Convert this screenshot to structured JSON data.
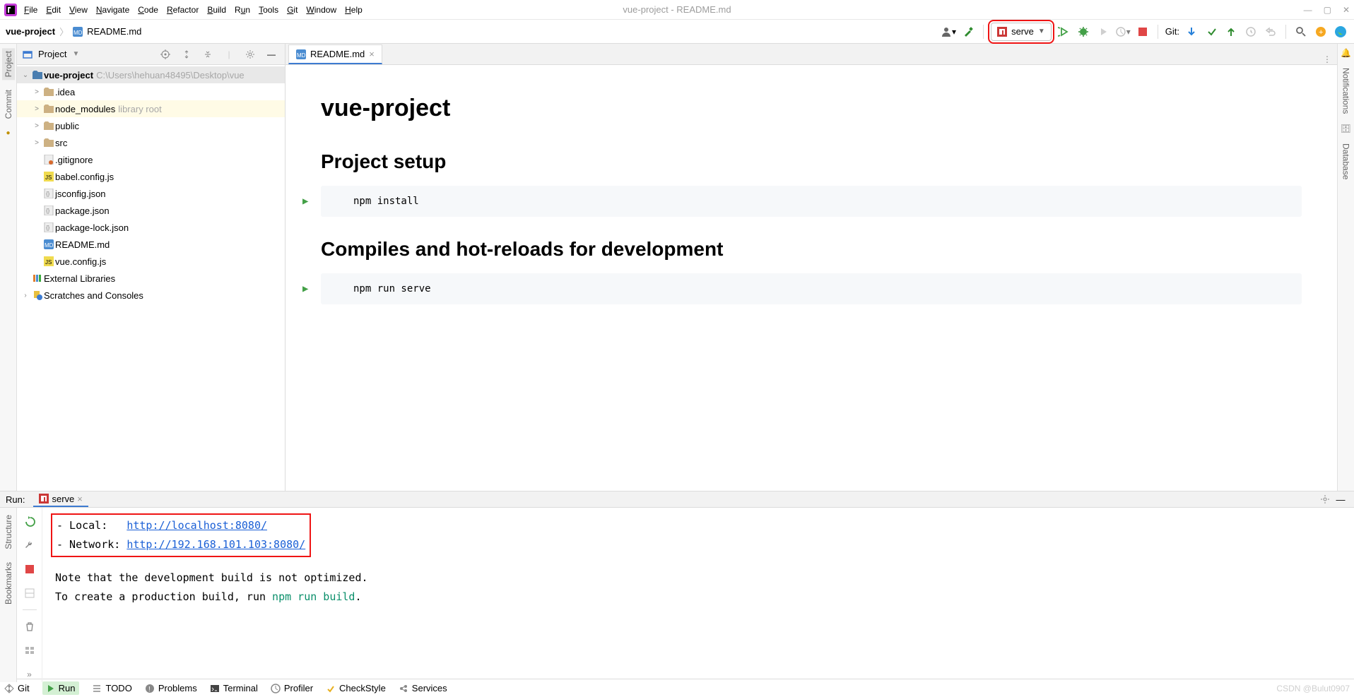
{
  "menu": {
    "items": [
      "File",
      "Edit",
      "View",
      "Navigate",
      "Code",
      "Refactor",
      "Build",
      "Run",
      "Tools",
      "Git",
      "Window",
      "Help"
    ]
  },
  "window": {
    "title": "vue-project - README.md"
  },
  "breadcrumb": {
    "root": "vue-project",
    "file": "README.md"
  },
  "toolbar": {
    "run_config": "serve",
    "git_label": "Git:"
  },
  "project": {
    "title": "Project",
    "root": "vue-project",
    "root_path": "C:\\Users\\hehuan48495\\Desktop\\vue",
    "items": [
      {
        "name": ".idea",
        "type": "dir",
        "indent": 2,
        "expand": ">"
      },
      {
        "name": "node_modules",
        "type": "dir",
        "indent": 2,
        "expand": ">",
        "note": "library root",
        "sel": true
      },
      {
        "name": "public",
        "type": "dir",
        "indent": 2,
        "expand": ">"
      },
      {
        "name": "src",
        "type": "dir",
        "indent": 2,
        "expand": ">"
      },
      {
        "name": ".gitignore",
        "type": "file",
        "indent": 2,
        "icon": "gitignore"
      },
      {
        "name": "babel.config.js",
        "type": "file",
        "indent": 2,
        "icon": "js"
      },
      {
        "name": "jsconfig.json",
        "type": "file",
        "indent": 2,
        "icon": "json"
      },
      {
        "name": "package.json",
        "type": "file",
        "indent": 2,
        "icon": "json"
      },
      {
        "name": "package-lock.json",
        "type": "file",
        "indent": 2,
        "icon": "json"
      },
      {
        "name": "README.md",
        "type": "file",
        "indent": 2,
        "icon": "md"
      },
      {
        "name": "vue.config.js",
        "type": "file",
        "indent": 2,
        "icon": "js"
      }
    ],
    "ext_lib": "External Libraries",
    "scratches": "Scratches and Consoles"
  },
  "editor": {
    "tab": "README.md",
    "h1": "vue-project",
    "h2a": "Project setup",
    "code_a": "npm install",
    "h2b": "Compiles and hot-reloads for development",
    "code_b": "npm run serve"
  },
  "run": {
    "title": "Run:",
    "tab": "serve",
    "local_lbl": "- Local:",
    "local_url": "http://localhost:8080/",
    "net_lbl": "- Network:",
    "net_url": "http://192.168.101.103:8080/",
    "note1": "Note that the development build is not optimized.",
    "note2_pre": "To create a production build, run ",
    "note2_cmd": "npm run build",
    "note2_post": "."
  },
  "left": {
    "project": "Project",
    "commit": "Commit",
    "structure": "Structure",
    "bookmarks": "Bookmarks"
  },
  "right": {
    "notifications": "Notifications",
    "database": "Database"
  },
  "status": {
    "git": "Git",
    "run": "Run",
    "todo": "TODO",
    "problems": "Problems",
    "terminal": "Terminal",
    "profiler": "Profiler",
    "checkstyle": "CheckStyle",
    "services": "Services",
    "watermark": "CSDN @Bulut0907"
  }
}
